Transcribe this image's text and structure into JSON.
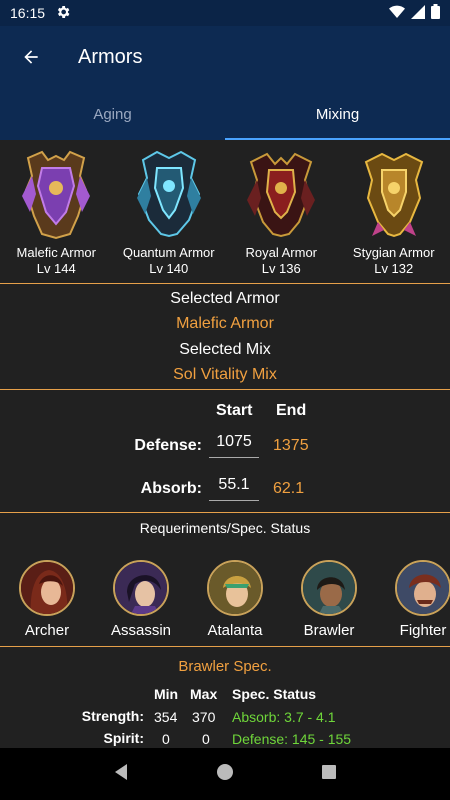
{
  "status": {
    "time": "16:15"
  },
  "appbar": {
    "title": "Armors"
  },
  "tabs": [
    {
      "label": "Aging"
    },
    {
      "label": "Mixing"
    }
  ],
  "armors": [
    {
      "name": "Malefic Armor",
      "level": "Lv 144"
    },
    {
      "name": "Quantum Armor",
      "level": "Lv 140"
    },
    {
      "name": "Royal Armor",
      "level": "Lv 136"
    },
    {
      "name": "Stygian Armor",
      "level": "Lv 132"
    }
  ],
  "selection": {
    "armor_label": "Selected Armor",
    "armor_value": "Malefic Armor",
    "mix_label": "Selected Mix",
    "mix_value": "Sol Vitality Mix"
  },
  "stats": {
    "start_header": "Start",
    "end_header": "End",
    "defense_label": "Defense:",
    "defense_start": "1075",
    "defense_end": "1375",
    "absorb_label": "Absorb:",
    "absorb_start": "55.1",
    "absorb_end": "62.1"
  },
  "requirements": {
    "title": "Requeriments/Spec. Status",
    "classes": [
      {
        "name": "Archer"
      },
      {
        "name": "Assassin"
      },
      {
        "name": "Atalanta"
      },
      {
        "name": "Brawler"
      },
      {
        "name": "Fighter"
      }
    ]
  },
  "spec": {
    "title": "Brawler Spec.",
    "min_header": "Min",
    "max_header": "Max",
    "status_header": "Spec. Status",
    "rows": [
      {
        "label": "Strength:",
        "min": "354",
        "max": "370",
        "status": "Absorb: 3.7 - 4.1"
      },
      {
        "label": "Spirit:",
        "min": "0",
        "max": "0",
        "status": "Defense: 145 - 155"
      }
    ]
  },
  "colors": {
    "accent": "#f0a040",
    "appbar": "#0d2a52",
    "positive": "#6fd63a"
  }
}
